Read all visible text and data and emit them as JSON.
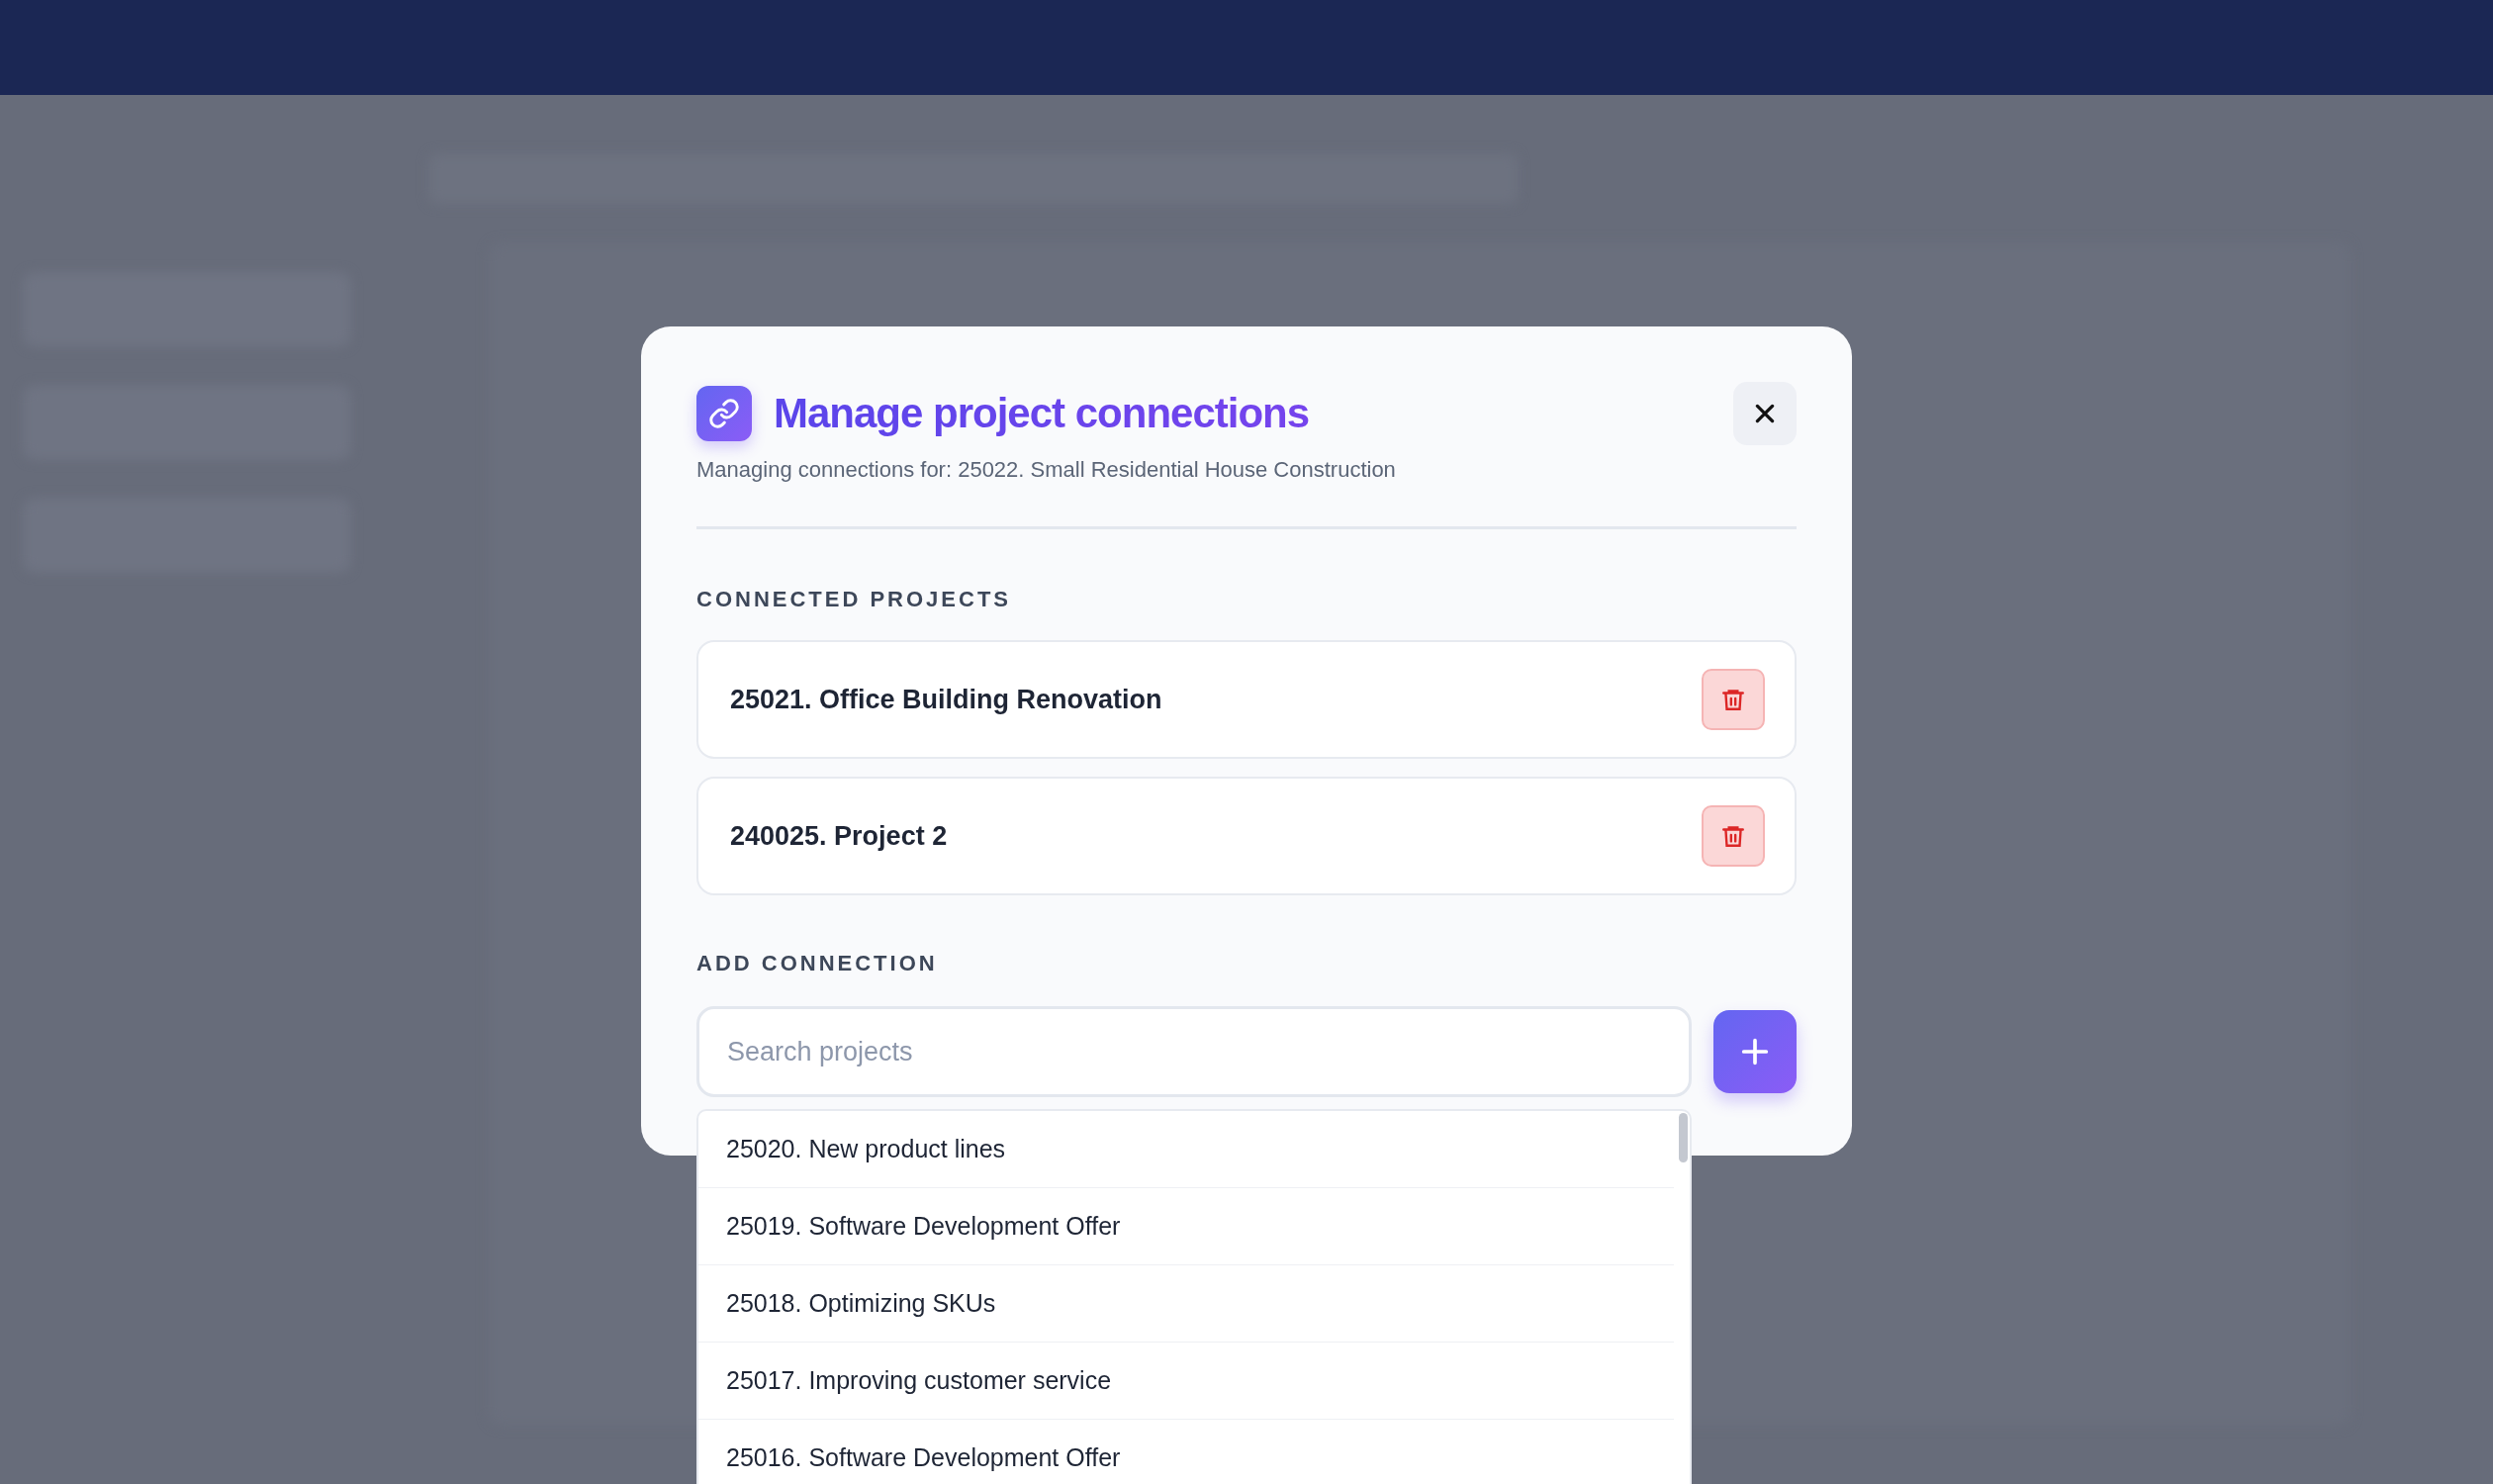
{
  "dialog": {
    "title": "Manage project connections",
    "subtitle": "Managing connections for: 25022. Small Residential House Construction",
    "connected": {
      "heading": "CONNECTED PROJECTS",
      "items": [
        {
          "name": "25021. Office Building Renovation"
        },
        {
          "name": "240025. Project 2"
        }
      ]
    },
    "add": {
      "heading": "ADD CONNECTION",
      "search": {
        "placeholder": "Search projects"
      },
      "results": [
        {
          "name": "25020. New product lines"
        },
        {
          "name": "25019. Software Development Offer"
        },
        {
          "name": "25018. Optimizing SKUs"
        },
        {
          "name": "25017. Improving customer service"
        },
        {
          "name": "25016. Software Development Offer"
        }
      ]
    }
  }
}
